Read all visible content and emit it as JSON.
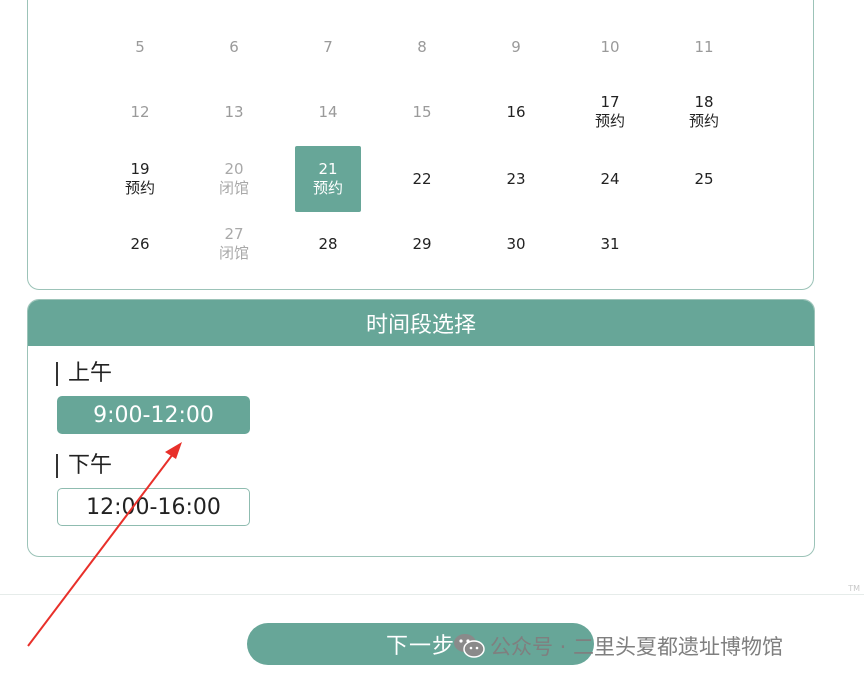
{
  "calendar": {
    "rows": [
      [
        {
          "day": "5",
          "status": "",
          "state": "past"
        },
        {
          "day": "6",
          "status": "",
          "state": "past"
        },
        {
          "day": "7",
          "status": "",
          "state": "past"
        },
        {
          "day": "8",
          "status": "",
          "state": "past"
        },
        {
          "day": "9",
          "status": "",
          "state": "past"
        },
        {
          "day": "10",
          "status": "",
          "state": "past"
        },
        {
          "day": "11",
          "status": "",
          "state": "past"
        }
      ],
      [
        {
          "day": "12",
          "status": "",
          "state": "past"
        },
        {
          "day": "13",
          "status": "",
          "state": "past"
        },
        {
          "day": "14",
          "status": "",
          "state": "past"
        },
        {
          "day": "15",
          "status": "",
          "state": "past"
        },
        {
          "day": "16",
          "status": "",
          "state": "avail"
        },
        {
          "day": "17",
          "status": "预约",
          "state": "avail"
        },
        {
          "day": "18",
          "status": "预约",
          "state": "avail"
        }
      ],
      [
        {
          "day": "19",
          "status": "预约",
          "state": "avail"
        },
        {
          "day": "20",
          "status": "闭馆",
          "state": "closed"
        },
        {
          "day": "21",
          "status": "预约",
          "state": "selected"
        },
        {
          "day": "22",
          "status": "",
          "state": "avail"
        },
        {
          "day": "23",
          "status": "",
          "state": "avail"
        },
        {
          "day": "24",
          "status": "",
          "state": "avail"
        },
        {
          "day": "25",
          "status": "",
          "state": "avail"
        }
      ],
      [
        {
          "day": "26",
          "status": "",
          "state": "avail"
        },
        {
          "day": "27",
          "status": "闭馆",
          "state": "closed"
        },
        {
          "day": "28",
          "status": "",
          "state": "avail"
        },
        {
          "day": "29",
          "status": "",
          "state": "avail"
        },
        {
          "day": "30",
          "status": "",
          "state": "avail"
        },
        {
          "day": "31",
          "status": "",
          "state": "avail"
        }
      ]
    ]
  },
  "time_selection": {
    "title": "时间段选择",
    "morning": {
      "label": "上午",
      "slot": "9:00-12:00",
      "selected": true
    },
    "afternoon": {
      "label": "下午",
      "slot": "12:00-16:00",
      "selected": false
    }
  },
  "footer": {
    "next_button": "下一步",
    "watermark": "公众号 · 二里头夏都遗址博物馆",
    "watermark_icon": "wechat-icon",
    "corner_mark": "TM"
  },
  "colors": {
    "accent": "#67a698",
    "border": "#9cc3b8",
    "annotation_arrow": "#e8302a"
  }
}
